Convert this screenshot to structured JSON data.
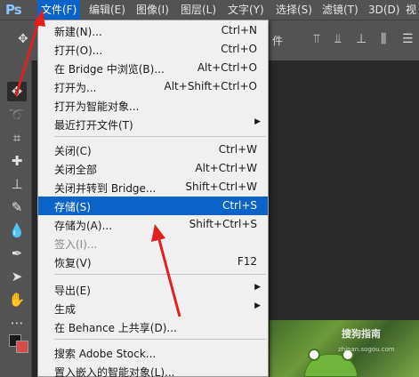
{
  "menubar": {
    "logo": "Ps",
    "items": [
      {
        "label": "文件(F)"
      },
      {
        "label": "编辑(E)"
      },
      {
        "label": "图像(I)"
      },
      {
        "label": "图层(L)"
      },
      {
        "label": "文字(Y)"
      },
      {
        "label": "选择(S)"
      },
      {
        "label": "滤镜(T)"
      },
      {
        "label": "3D(D)"
      },
      {
        "label": "视"
      }
    ]
  },
  "optbar": {
    "label_fragment": "件"
  },
  "file_menu": {
    "items": [
      {
        "label": "新建(N)...",
        "shortcut": "Ctrl+N"
      },
      {
        "label": "打开(O)...",
        "shortcut": "Ctrl+O"
      },
      {
        "label": "在 Bridge 中浏览(B)...",
        "shortcut": "Alt+Ctrl+O"
      },
      {
        "label": "打开为...",
        "shortcut": "Alt+Shift+Ctrl+O"
      },
      {
        "label": "打开为智能对象...",
        "shortcut": ""
      },
      {
        "label": "最近打开文件(T)",
        "shortcut": ""
      },
      {
        "label": "关闭(C)",
        "shortcut": "Ctrl+W"
      },
      {
        "label": "关闭全部",
        "shortcut": "Alt+Ctrl+W"
      },
      {
        "label": "关闭并转到 Bridge...",
        "shortcut": "Shift+Ctrl+W"
      },
      {
        "label": "存储(S)",
        "shortcut": "Ctrl+S"
      },
      {
        "label": "存储为(A)...",
        "shortcut": "Shift+Ctrl+S"
      },
      {
        "label": "签入(I)...",
        "shortcut": ""
      },
      {
        "label": "恢复(V)",
        "shortcut": "F12"
      },
      {
        "label": "导出(E)",
        "shortcut": ""
      },
      {
        "label": "生成",
        "shortcut": ""
      },
      {
        "label": "在 Behance 上共享(D)...",
        "shortcut": ""
      },
      {
        "label": "搜索 Adobe Stock...",
        "shortcut": ""
      },
      {
        "label": "置入嵌入的智能对象(L)...",
        "shortcut": ""
      }
    ]
  },
  "canvas": {
    "watermark": "搜狗指南",
    "watermark_url": "zhinan.sogou.com"
  },
  "colors": {
    "highlight": "#0a63c9",
    "annotation_arrow": "#e02020"
  },
  "icons": {
    "move": "move-icon",
    "submenu": "chevron-right-icon"
  }
}
